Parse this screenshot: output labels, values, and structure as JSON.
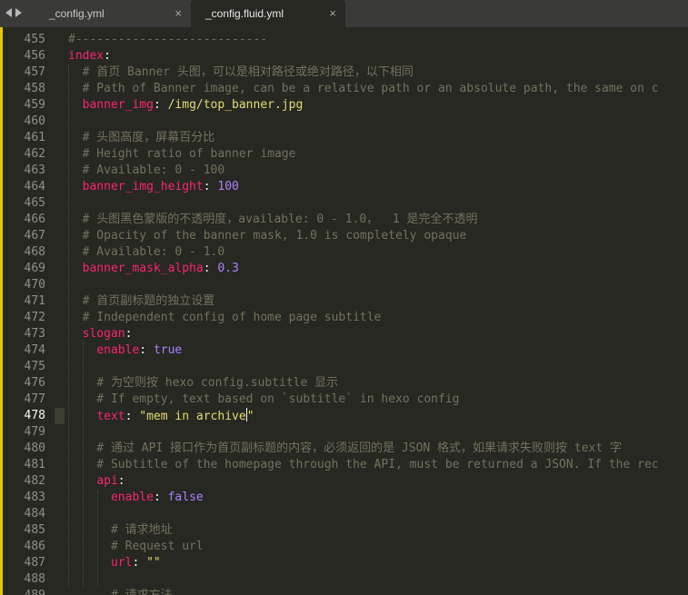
{
  "tabs": [
    {
      "label": "_config.yml",
      "active": false,
      "close_glyph": "×"
    },
    {
      "label": "_config.fluid.yml",
      "active": true,
      "close_glyph": "×"
    }
  ],
  "nav": {
    "left_icon": "chevron-left-icon",
    "right_icon": "chevron-right-icon"
  },
  "colors": {
    "background": "#272822",
    "comment": "#75715e",
    "key": "#f92672",
    "string": "#e6db74",
    "number": "#ae81ff",
    "text": "#f8f8f2",
    "gutter_marker": "#e6c800"
  },
  "current_line": 478,
  "lines": [
    {
      "n": "455",
      "segs": [
        {
          "t": "#---------------------------",
          "c": "cm"
        }
      ]
    },
    {
      "n": "456",
      "segs": [
        {
          "t": "index",
          "c": "key"
        },
        {
          "t": ":",
          "c": ""
        }
      ]
    },
    {
      "n": "457",
      "segs": [
        {
          "t": "  # 首页 Banner 头图，可以是相对路径或绝对路径，以下相同",
          "c": "cm"
        }
      ]
    },
    {
      "n": "458",
      "segs": [
        {
          "t": "  # Path of Banner image, can be a relative path or an absolute path, the same on c",
          "c": "cm"
        }
      ]
    },
    {
      "n": "459",
      "segs": [
        {
          "t": "  ",
          "c": ""
        },
        {
          "t": "banner_img",
          "c": "key"
        },
        {
          "t": ": ",
          "c": ""
        },
        {
          "t": "/img/top_banner.jpg",
          "c": "str"
        }
      ]
    },
    {
      "n": "460",
      "segs": []
    },
    {
      "n": "461",
      "segs": [
        {
          "t": "  # 头图高度，屏幕百分比",
          "c": "cm"
        }
      ]
    },
    {
      "n": "462",
      "segs": [
        {
          "t": "  # Height ratio of banner image",
          "c": "cm"
        }
      ]
    },
    {
      "n": "463",
      "segs": [
        {
          "t": "  # Available: 0 - 100",
          "c": "cm"
        }
      ]
    },
    {
      "n": "464",
      "segs": [
        {
          "t": "  ",
          "c": ""
        },
        {
          "t": "banner_img_height",
          "c": "key"
        },
        {
          "t": ": ",
          "c": ""
        },
        {
          "t": "100",
          "c": "num"
        }
      ]
    },
    {
      "n": "465",
      "segs": []
    },
    {
      "n": "466",
      "segs": [
        {
          "t": "  # 头图黑色蒙版的不透明度，available: 0 - 1.0，  1 是完全不透明",
          "c": "cm"
        }
      ]
    },
    {
      "n": "467",
      "segs": [
        {
          "t": "  # Opacity of the banner mask, 1.0 is completely opaque",
          "c": "cm"
        }
      ]
    },
    {
      "n": "468",
      "segs": [
        {
          "t": "  # Available: 0 - 1.0",
          "c": "cm"
        }
      ]
    },
    {
      "n": "469",
      "segs": [
        {
          "t": "  ",
          "c": ""
        },
        {
          "t": "banner_mask_alpha",
          "c": "key"
        },
        {
          "t": ": ",
          "c": ""
        },
        {
          "t": "0.3",
          "c": "num"
        }
      ]
    },
    {
      "n": "470",
      "segs": []
    },
    {
      "n": "471",
      "segs": [
        {
          "t": "  # 首页副标题的独立设置",
          "c": "cm"
        }
      ]
    },
    {
      "n": "472",
      "segs": [
        {
          "t": "  # Independent config of home page subtitle",
          "c": "cm"
        }
      ]
    },
    {
      "n": "473",
      "segs": [
        {
          "t": "  ",
          "c": ""
        },
        {
          "t": "slogan",
          "c": "key"
        },
        {
          "t": ":",
          "c": ""
        }
      ]
    },
    {
      "n": "474",
      "segs": [
        {
          "t": "    ",
          "c": ""
        },
        {
          "t": "enable",
          "c": "key"
        },
        {
          "t": ": ",
          "c": ""
        },
        {
          "t": "true",
          "c": "num"
        }
      ]
    },
    {
      "n": "475",
      "segs": []
    },
    {
      "n": "476",
      "segs": [
        {
          "t": "    # 为空则按 hexo config.subtitle 显示",
          "c": "cm"
        }
      ]
    },
    {
      "n": "477",
      "segs": [
        {
          "t": "    # If empty, text based on `subtitle` in hexo config",
          "c": "cm"
        }
      ]
    },
    {
      "n": "478",
      "segs": [
        {
          "t": "    ",
          "c": ""
        },
        {
          "t": "text",
          "c": "key"
        },
        {
          "t": ": ",
          "c": ""
        },
        {
          "t": "\"mem in archive",
          "c": "str"
        },
        {
          "t": "|CARET|",
          "c": "caret"
        },
        {
          "t": "\"",
          "c": "str"
        }
      ]
    },
    {
      "n": "479",
      "segs": []
    },
    {
      "n": "480",
      "segs": [
        {
          "t": "    # 通过 API 接口作为首页副标题的内容，必须返回的是 JSON 格式，如果请求失败则按 text 字",
          "c": "cm"
        }
      ]
    },
    {
      "n": "481",
      "segs": [
        {
          "t": "    # Subtitle of the homepage through the API, must be returned a JSON. If the rec",
          "c": "cm"
        }
      ]
    },
    {
      "n": "482",
      "segs": [
        {
          "t": "    ",
          "c": ""
        },
        {
          "t": "api",
          "c": "key"
        },
        {
          "t": ":",
          "c": ""
        }
      ]
    },
    {
      "n": "483",
      "segs": [
        {
          "t": "      ",
          "c": ""
        },
        {
          "t": "enable",
          "c": "key"
        },
        {
          "t": ": ",
          "c": ""
        },
        {
          "t": "false",
          "c": "num"
        }
      ]
    },
    {
      "n": "484",
      "segs": []
    },
    {
      "n": "485",
      "segs": [
        {
          "t": "      # 请求地址",
          "c": "cm"
        }
      ]
    },
    {
      "n": "486",
      "segs": [
        {
          "t": "      # Request url",
          "c": "cm"
        }
      ]
    },
    {
      "n": "487",
      "segs": [
        {
          "t": "      ",
          "c": ""
        },
        {
          "t": "url",
          "c": "key"
        },
        {
          "t": ": ",
          "c": ""
        },
        {
          "t": "\"\"",
          "c": "str"
        }
      ]
    },
    {
      "n": "488",
      "segs": []
    },
    {
      "n": "489",
      "segs": [
        {
          "t": "      # 请求方法",
          "c": "cm"
        }
      ]
    }
  ]
}
